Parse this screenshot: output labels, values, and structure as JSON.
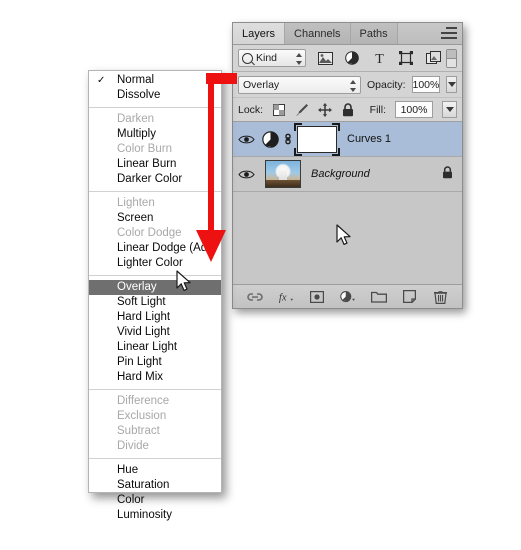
{
  "blend_menu": {
    "groups": [
      {
        "items": [
          {
            "label": "Normal",
            "state": "enabled",
            "checked": true
          },
          {
            "label": "Dissolve",
            "state": "enabled",
            "checked": false
          }
        ]
      },
      {
        "items": [
          {
            "label": "Darken",
            "state": "disabled",
            "checked": false
          },
          {
            "label": "Multiply",
            "state": "enabled",
            "checked": false
          },
          {
            "label": "Color Burn",
            "state": "disabled",
            "checked": false
          },
          {
            "label": "Linear Burn",
            "state": "enabled",
            "checked": false
          },
          {
            "label": "Darker Color",
            "state": "enabled",
            "checked": false
          }
        ]
      },
      {
        "items": [
          {
            "label": "Lighten",
            "state": "disabled",
            "checked": false
          },
          {
            "label": "Screen",
            "state": "enabled",
            "checked": false
          },
          {
            "label": "Color Dodge",
            "state": "disabled",
            "checked": false
          },
          {
            "label": "Linear Dodge (Add)",
            "state": "enabled",
            "checked": false
          },
          {
            "label": "Lighter Color",
            "state": "enabled",
            "checked": false
          }
        ]
      },
      {
        "items": [
          {
            "label": "Overlay",
            "state": "selected",
            "checked": false
          },
          {
            "label": "Soft Light",
            "state": "enabled",
            "checked": false
          },
          {
            "label": "Hard Light",
            "state": "enabled",
            "checked": false
          },
          {
            "label": "Vivid Light",
            "state": "enabled",
            "checked": false
          },
          {
            "label": "Linear Light",
            "state": "enabled",
            "checked": false
          },
          {
            "label": "Pin Light",
            "state": "enabled",
            "checked": false
          },
          {
            "label": "Hard Mix",
            "state": "enabled",
            "checked": false
          }
        ]
      },
      {
        "items": [
          {
            "label": "Difference",
            "state": "disabled",
            "checked": false
          },
          {
            "label": "Exclusion",
            "state": "disabled",
            "checked": false
          },
          {
            "label": "Subtract",
            "state": "disabled",
            "checked": false
          },
          {
            "label": "Divide",
            "state": "disabled",
            "checked": false
          }
        ]
      },
      {
        "items": [
          {
            "label": "Hue",
            "state": "enabled",
            "checked": false
          },
          {
            "label": "Saturation",
            "state": "enabled",
            "checked": false
          },
          {
            "label": "Color",
            "state": "enabled",
            "checked": false
          },
          {
            "label": "Luminosity",
            "state": "enabled",
            "checked": false
          }
        ]
      }
    ],
    "check_glyph": "✓"
  },
  "annotation": {
    "arrow_color": "#ee1111",
    "shape": "elbow-down-arrow"
  },
  "panel": {
    "tabs": [
      {
        "label": "Layers",
        "active": true
      },
      {
        "label": "Channels",
        "active": false
      },
      {
        "label": "Paths",
        "active": false
      }
    ],
    "menu_icon": "panel-menu-icon",
    "filter": {
      "kind_label": "Kind",
      "search_icon": "magnifier-icon",
      "icons": [
        "pixel-layer-filter-icon",
        "adjustment-layer-filter-icon",
        "type-layer-filter-icon",
        "shape-layer-filter-icon",
        "smart-object-filter-icon"
      ],
      "toggle": "filter-enable-toggle"
    },
    "blend": {
      "mode": "Overlay",
      "opacity_label": "Opacity:",
      "opacity_value": "100%"
    },
    "lock": {
      "label": "Lock:",
      "icons": [
        "lock-transparency-icon",
        "lock-image-pixels-icon",
        "lock-position-icon",
        "lock-all-icon"
      ],
      "fill_label": "Fill:",
      "fill_value": "100%"
    },
    "layers": [
      {
        "name": "Curves 1",
        "type": "adjustment",
        "selected": true,
        "visible": true,
        "italic": false,
        "locked": false,
        "has_mask": true
      },
      {
        "name": "Background",
        "type": "image",
        "selected": false,
        "visible": true,
        "italic": true,
        "locked": true,
        "has_mask": false
      }
    ],
    "footer_icons": [
      "link-layers-icon",
      "layer-style-fx-icon",
      "add-layer-mask-icon",
      "new-adjustment-layer-icon",
      "new-group-icon",
      "new-layer-icon",
      "delete-layer-icon"
    ],
    "colors": {
      "selected_row": "#a9bdd8",
      "panel_bg": "#d4d4d4",
      "list_bg": "#c7c7c7"
    }
  },
  "cursor": {
    "pointers": [
      "menu-overlay-pointer",
      "panel-pointer"
    ]
  }
}
